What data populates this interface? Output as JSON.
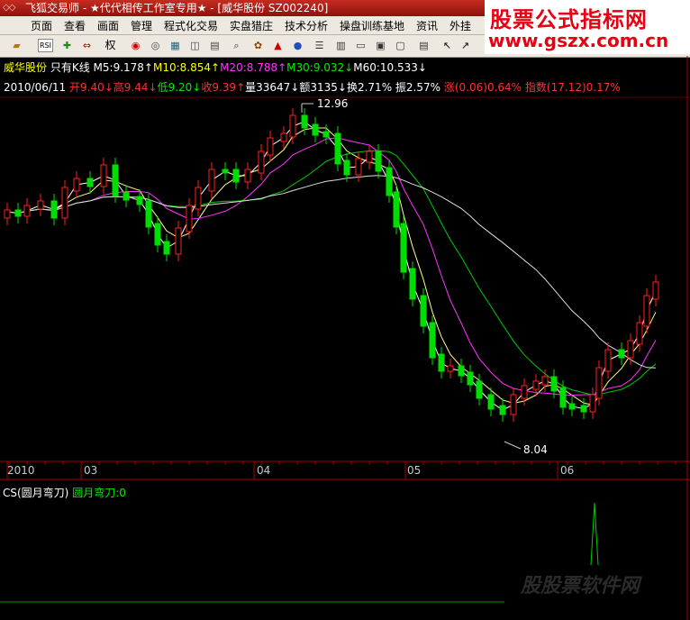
{
  "window": {
    "title": "飞狐交易师 - ★代代相传工作室专用★ - [威华股份  SZ002240]"
  },
  "brand": {
    "line1": "股票公式指标网",
    "line2": "www.gszx.com.cn"
  },
  "menu": [
    "页面",
    "查看",
    "画面",
    "管理",
    "程式化交易",
    "实盘猎庄",
    "技术分析",
    "操盘训练基地",
    "资讯",
    "外挂"
  ],
  "toolbar_icons": [
    "folder-icon",
    "rsi-icon",
    "crosshair-icon",
    "arrows-icon",
    "weight-label",
    "chart-icon-1",
    "chart-icon-2",
    "chart-icon-3",
    "cube-icon",
    "book-icon",
    "search-icon",
    "settings-icon",
    "alarm-icon",
    "info-icon",
    "list-icon",
    "grid-icon",
    "window-icon",
    "image-icon",
    "pointer-icon",
    "draw-line-icon"
  ],
  "toolbar_weight_label": "权",
  "stock": {
    "name": "威华股份",
    "mode": "只有K线",
    "ma5": "M5:9.178↑",
    "ma10": "M10:8.854↑",
    "ma20": "M20:8.788↑",
    "ma30": "M30:9.032↓",
    "ma60": "M60:10.533↓",
    "date": "2010/06/11",
    "open": "开9.40↓",
    "high": "高9.44↓",
    "low": "低9.20↓",
    "close": "收9.39↑",
    "volume": "量33647↓",
    "amount": "额3135↓",
    "turnover": "换2.71%",
    "amplitude": "振2.57%",
    "change": "涨(0.06)0.64%",
    "index": "指数(17.12)0.17%",
    "peak_label": "12.96",
    "trough_label": "8.04"
  },
  "time_axis": [
    "2010",
    "03",
    "04",
    "05",
    "06"
  ],
  "indicator": {
    "name": "CS(圆月弯刀)",
    "value": "圆月弯刀:0"
  },
  "watermark": "股股票软件网",
  "colors": {
    "up": "#ff3030",
    "down": "#00dd00",
    "ma5": "#ffffff",
    "ma10": "#ffff00",
    "ma20": "#ff33ff",
    "ma30": "#00ee00",
    "ma60": "#ffffff"
  }
}
